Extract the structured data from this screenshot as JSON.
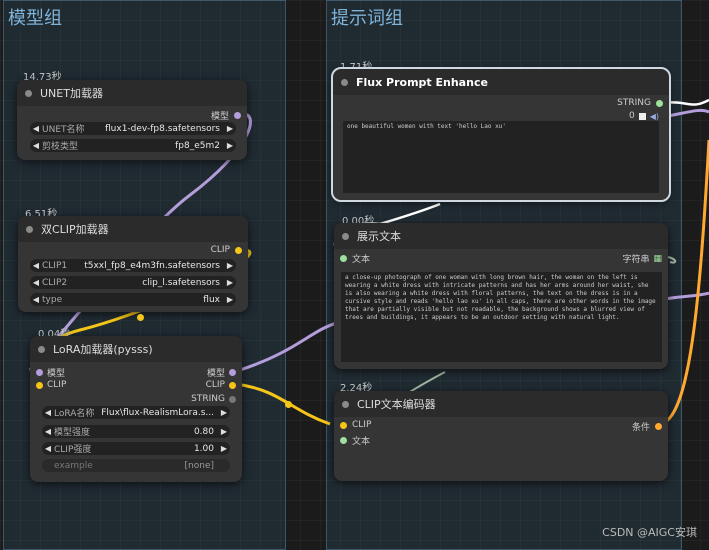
{
  "groups": [
    {
      "title": "模型组"
    },
    {
      "title": "提示词组"
    }
  ],
  "nodes": {
    "unet": {
      "time": "14.73秒",
      "title": "UNET加载器",
      "output": "模型",
      "widgets": [
        {
          "label": "UNET名称",
          "value": "flux1-dev-fp8.safetensors"
        },
        {
          "label": "剪枝类型",
          "value": "fp8_e5m2"
        }
      ]
    },
    "dualclip": {
      "time": "6.51秒",
      "title": "双CLIP加载器",
      "output": "CLIP",
      "widgets": [
        {
          "label": "CLIP1",
          "value": "t5xxl_fp8_e4m3fn.safetensors"
        },
        {
          "label": "CLIP2",
          "value": "clip_l.safetensors"
        },
        {
          "label": "type",
          "value": "flux"
        }
      ]
    },
    "lora": {
      "time": "0.04秒",
      "title": "LoRA加载器(pysss)",
      "inputs": [
        "模型",
        "CLIP"
      ],
      "outputs": [
        "模型",
        "CLIP",
        "STRING"
      ],
      "widgets": [
        {
          "label": "LoRA名称",
          "value": "Flux\\flux-RealismLora.s..."
        },
        {
          "label": "模型强度",
          "value": "0.80"
        },
        {
          "label": "CLIP强度",
          "value": "1.00"
        },
        {
          "label": "example",
          "value": "[none]"
        }
      ]
    },
    "enhance": {
      "time": "1.71秒",
      "title": "Flux Prompt Enhance",
      "output": "STRING",
      "seed": "0",
      "text": "one beautiful women with text 'hello Lao xu'"
    },
    "show": {
      "time": "0.00秒",
      "title": "展示文本",
      "input": "文本",
      "output": "字符串",
      "text": "a close-up photograph of one woman with long brown hair, the woman on the left is wearing a white dress with intricate patterns and has her arms around her waist, she is also wearing a white dress with floral patterns, the text on the dress is in a cursive style and reads 'hello lao xu' in all caps, there are other words in the image that are partially visible but not readable, the background shows a blurred view of trees and buildings, it appears to be an outdoor setting with natural light."
    },
    "clipenc": {
      "time": "2.24秒",
      "title": "CLIP文本编码器",
      "inputs": [
        "CLIP",
        "文本"
      ],
      "output": "条件"
    }
  },
  "colors": {
    "model_wire": "#b39ddb",
    "clip_wire": "#f5c518",
    "string_wire": "#ffffff",
    "cond_wire": "#ffa931",
    "text_wire": "#9fb39f"
  },
  "watermark": "CSDN @AIGC安琪"
}
